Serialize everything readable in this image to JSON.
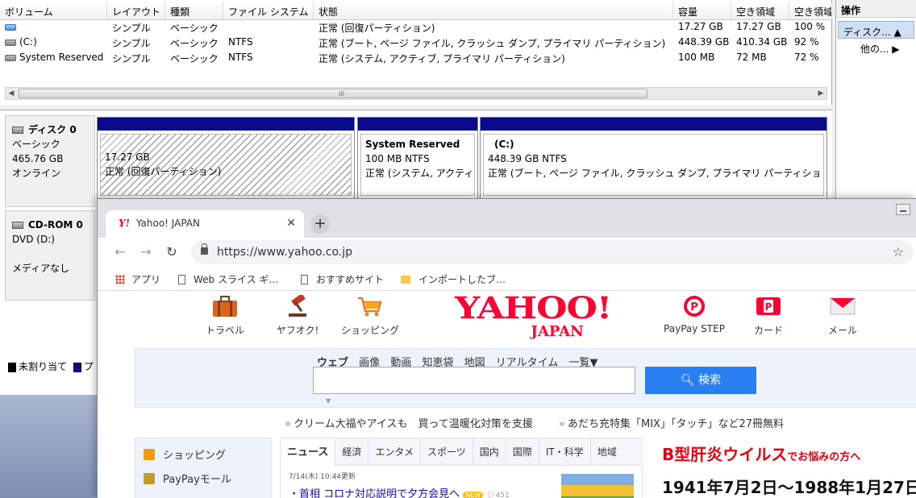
{
  "disk_mgmt": {
    "columns": [
      "ボリューム",
      "レイアウト",
      "種類",
      "ファイル システム",
      "状態",
      "容量",
      "空き領域",
      "空き領域"
    ],
    "rows": [
      [
        "",
        "シンプル",
        "ベーシック",
        "",
        "正常 (回復パーティション)",
        "17.27 GB",
        "17.27 GB",
        "100 %"
      ],
      [
        "(C:)",
        "シンプル",
        "ベーシック",
        "NTFS",
        "正常 (ブート, ページ ファイル, クラッシュ ダンプ, プライマリ パーティション)",
        "448.39 GB",
        "410.34 GB",
        "92 %"
      ],
      [
        "System Reserved",
        "シンプル",
        "ベーシック",
        "NTFS",
        "正常 (システム, アクティブ, プライマリ パーティション)",
        "100 MB",
        "72 MB",
        "72 %"
      ]
    ],
    "scroll_grip": "III",
    "ops": {
      "title": "操作",
      "disk": "ディスク...",
      "other": "他の..."
    },
    "disk0": {
      "name": "ディスク 0",
      "type": "ベーシック",
      "size": "465.76 GB",
      "state": "オンライン",
      "partitions": [
        {
          "title": "",
          "size": "17.27 GB",
          "status": "正常 (回復パーティション)"
        },
        {
          "title": "System Reserved",
          "size": "100 MB NTFS",
          "status": "正常 (システム, アクティ"
        },
        {
          "title": "(C:)",
          "size": "448.39 GB NTFS",
          "status": "正常 (ブート, ページ ファイル, クラッシュ ダンプ, プライマリ パーティショ"
        }
      ]
    },
    "cdrom": {
      "name": "CD-ROM 0",
      "drive": "DVD (D:)",
      "state": "メディアなし"
    },
    "legend": {
      "unallocated": "未割り当て",
      "primary": "プ"
    }
  },
  "chrome": {
    "tab_title": "Yahoo! JAPAN",
    "tab_favicon": "Y!",
    "url": "https://www.yahoo.co.jp",
    "bookmarks": [
      "アプリ",
      "Web スライス ギ…",
      "おすすめサイト",
      "インポートしたブ…"
    ]
  },
  "yahoo": {
    "services_left": [
      "トラベル",
      "ヤフオク!",
      "ショッピング"
    ],
    "services_right": [
      "PayPay STEP",
      "カード",
      "メール"
    ],
    "logo_main": "YAHOO!",
    "logo_sub": "JAPAN",
    "search_tabs": [
      "ウェブ",
      "画像",
      "動画",
      "知恵袋",
      "地図",
      "リアルタイム",
      "一覧▼"
    ],
    "search_button": "検索",
    "promo": [
      "クリーム大福やアイスも　買って温暖化対策を支援",
      "あだち充特集「MIX」「タッチ」など27冊無料"
    ],
    "left_nav": [
      "ショッピング",
      "PayPayモール"
    ],
    "news_tabs": [
      "ニュース",
      "経済",
      "エンタメ",
      "スポーツ",
      "国内",
      "国際",
      "IT・科学",
      "地域"
    ],
    "news_time": "7/14(木) 10:44更新",
    "news_headline": "・首相 コロナ対応説明で夕方会見へ",
    "news_new": "NEW",
    "news_count": "451",
    "ad_title": "B型肝炎ウイルス",
    "ad_title_suffix": "でお悩みの方へ",
    "ad_sub": "1941年7月2日～1988年1月27日"
  },
  "colors": {
    "yahoo_red": "#ff0033",
    "partition_bar": "#0a0a8c",
    "search_blue": "#2a7ff0"
  }
}
